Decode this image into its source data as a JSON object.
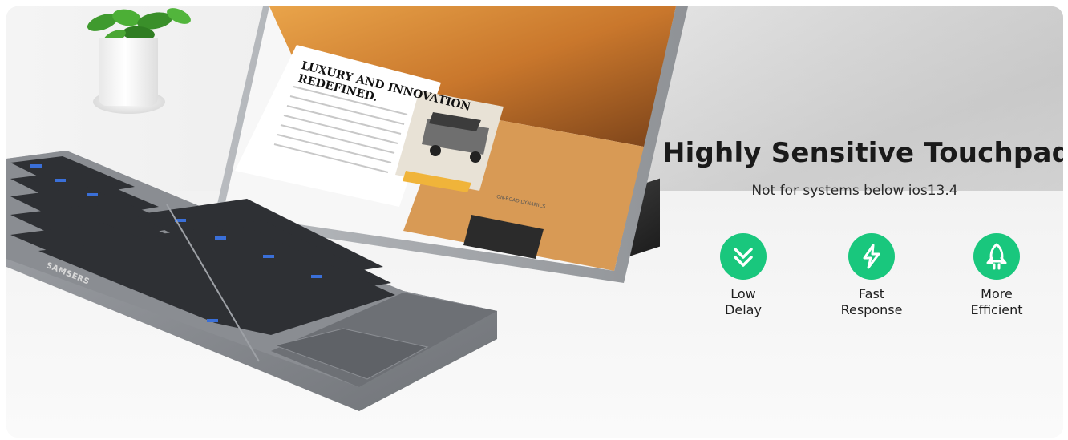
{
  "headline": "Highly Sensitive Touchpad",
  "subline": "Not for systems below ios13.4",
  "features": [
    {
      "icon": "double-chevron-down-icon",
      "line1": "Low",
      "line2": "Delay"
    },
    {
      "icon": "lightning-bolt-icon",
      "line1": "Fast",
      "line2": "Response"
    },
    {
      "icon": "rocket-icon",
      "line1": "More",
      "line2": "Efficient"
    }
  ],
  "tablet_screen": {
    "title_line1": "LUXURY AND INNOVATION",
    "title_line2": "REDEFINED.",
    "caption": "ON-ROAD DYNAMICS"
  },
  "keyboard_brand": "SAMSERS",
  "colors": {
    "accent": "#19c77d",
    "headline": "#1a1a1a",
    "keyboard_body": "#8a8d92"
  }
}
